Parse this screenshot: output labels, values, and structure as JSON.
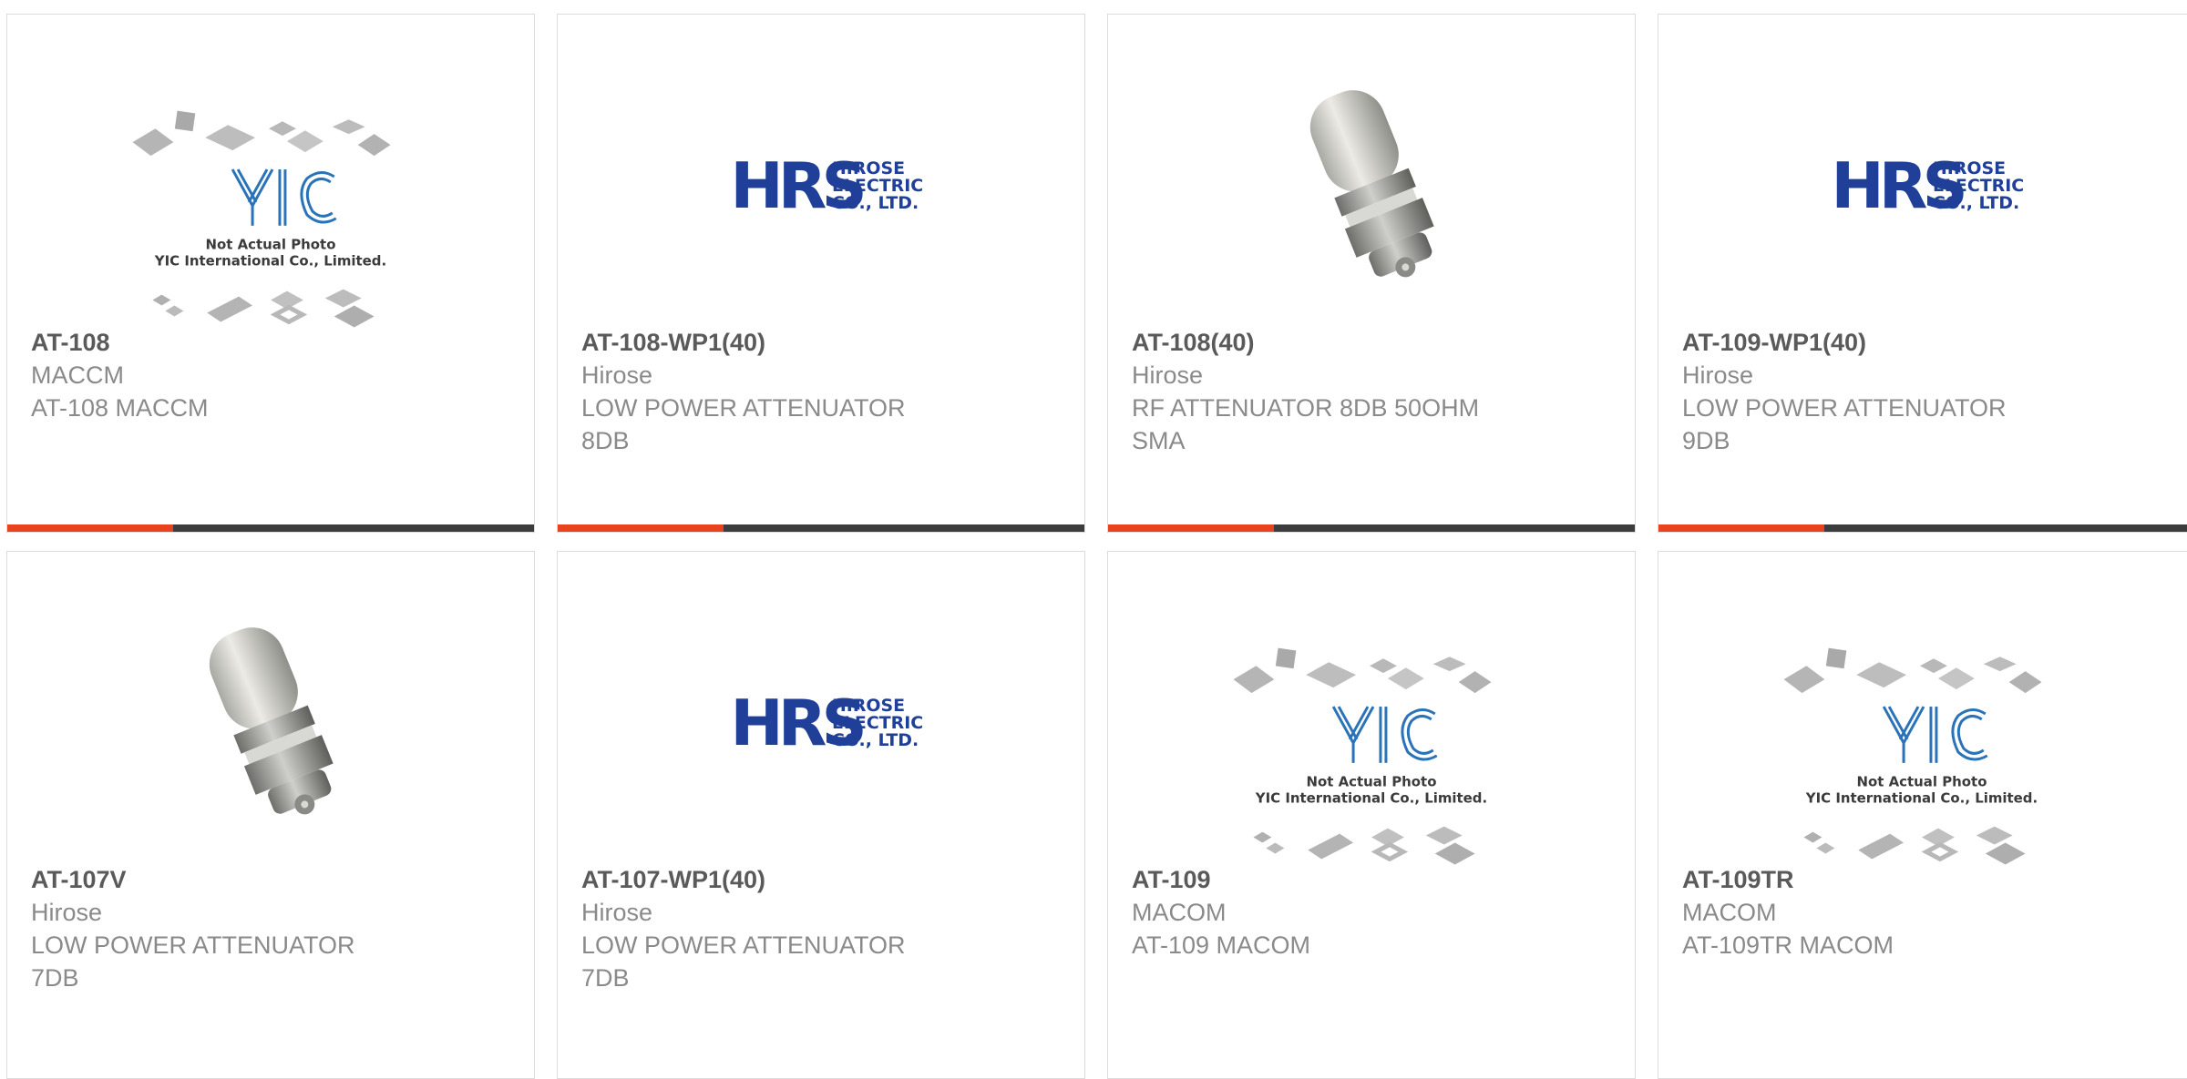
{
  "colors": {
    "accent": "#e8431c",
    "bar_dark": "#3c3c3c",
    "hirose_blue": "#1f3f99",
    "yic_blue": "#2a73b8"
  },
  "placeholders": {
    "yic": {
      "line1": "Not Actual Photo",
      "line2": "YIC International Co., Limited.",
      "logo": "YIC"
    },
    "hrs": {
      "mark": "HRS",
      "line1": "HIROSE",
      "line2": "ELECTRIC",
      "line3": "CO., LTD."
    }
  },
  "products": [
    {
      "part": "AT-108",
      "mfr": "MACCM",
      "desc": "AT-108 MACCM",
      "image": "yic-placeholder"
    },
    {
      "part": "AT-108-WP1(40)",
      "mfr": "Hirose",
      "desc": "LOW POWER ATTENUATOR\n8DB",
      "image": "hirose-logo"
    },
    {
      "part": "AT-108(40)",
      "mfr": "Hirose",
      "desc": "RF ATTENUATOR 8DB 50OHM\nSMA",
      "image": "attenuator-photo"
    },
    {
      "part": "AT-109-WP1(40)",
      "mfr": "Hirose",
      "desc": "LOW POWER ATTENUATOR\n9DB",
      "image": "hirose-logo"
    },
    {
      "part": "AT-107V",
      "mfr": "Hirose",
      "desc": "LOW POWER ATTENUATOR\n7DB",
      "image": "attenuator-photo"
    },
    {
      "part": "AT-107-WP1(40)",
      "mfr": "Hirose",
      "desc": "LOW POWER ATTENUATOR\n7DB",
      "image": "hirose-logo"
    },
    {
      "part": "AT-109",
      "mfr": "MACOM",
      "desc": "AT-109 MACOM",
      "image": "yic-placeholder"
    },
    {
      "part": "AT-109TR",
      "mfr": "MACOM",
      "desc": "AT-109TR MACOM",
      "image": "yic-placeholder"
    }
  ]
}
